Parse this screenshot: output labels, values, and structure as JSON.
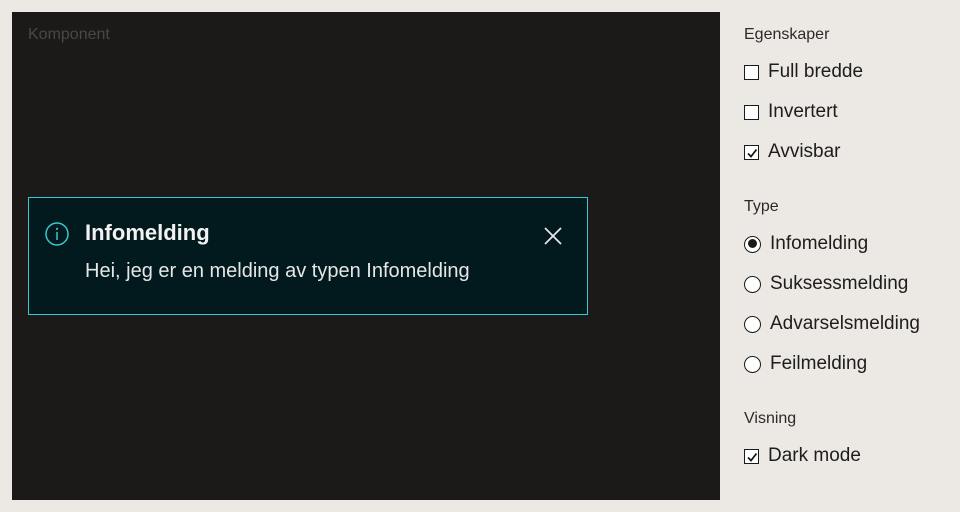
{
  "preview": {
    "label": "Komponent",
    "background": "#1c1a19"
  },
  "alert": {
    "variant": "info",
    "icon": "info-circle-icon",
    "title": "Infomelding",
    "message": "Hei, jeg er en melding av typen Infomelding",
    "close_icon": "close-icon",
    "border_color": "#38c8d0",
    "background": "#021a1e"
  },
  "panel": {
    "egenskaper": {
      "title": "Egenskaper",
      "options": [
        {
          "label": "Full bredde",
          "checked": false
        },
        {
          "label": "Invertert",
          "checked": false
        },
        {
          "label": "Avvisbar",
          "checked": true
        }
      ]
    },
    "type": {
      "title": "Type",
      "options": [
        {
          "label": "Infomelding",
          "selected": true
        },
        {
          "label": "Suksessmelding",
          "selected": false
        },
        {
          "label": "Advarselsmelding",
          "selected": false
        },
        {
          "label": "Feilmelding",
          "selected": false
        }
      ]
    },
    "visning": {
      "title": "Visning",
      "options": [
        {
          "label": "Dark mode",
          "checked": true
        }
      ]
    }
  }
}
